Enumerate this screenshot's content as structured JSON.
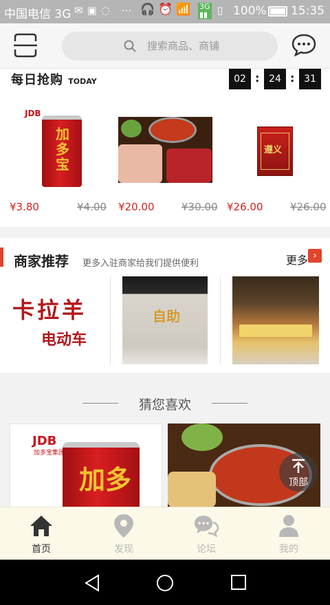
{
  "status_bar": {
    "carrier": "中国电信 3G",
    "battery": "100%",
    "time": "15:35"
  },
  "header": {
    "search_placeholder": "搜索商品、商铺"
  },
  "flash_sale": {
    "title": "每日抢购",
    "title_en": "TODAY",
    "countdown": [
      "02",
      "24",
      "31"
    ],
    "products": [
      {
        "price": "¥3.80",
        "old_price": "¥4.00"
      },
      {
        "price": "¥20.00",
        "old_price": "¥30.00"
      },
      {
        "price": "¥26.00",
        "old_price": "¥26.00"
      }
    ]
  },
  "merchant": {
    "title": "商家推荐",
    "subtitle": "更多入驻商家给我们提供便利",
    "more": "更多",
    "brand_line1": "卡拉羊",
    "brand_line2": "电动车",
    "sign_text": "自助"
  },
  "guess": {
    "title": "猜您喜欢",
    "product_logo": "JDB",
    "product_logo_sub": "加多宝集团",
    "can_text": "加多"
  },
  "products": {
    "can_brand": "JDB",
    "can_text": "加多宝",
    "box_text": "遵义"
  },
  "to_top": "顶部",
  "tabs": [
    {
      "label": "首页",
      "icon": "home-icon",
      "active": true
    },
    {
      "label": "发现",
      "icon": "map-pin-icon",
      "active": false
    },
    {
      "label": "论坛",
      "icon": "chat-bubbles-icon",
      "active": false
    },
    {
      "label": "我的",
      "icon": "user-icon",
      "active": false
    }
  ],
  "colors": {
    "accent": "#e0452b",
    "price": "#d0231e",
    "tab_active": "#333333",
    "tab_inactive": "#b8b8b8"
  }
}
